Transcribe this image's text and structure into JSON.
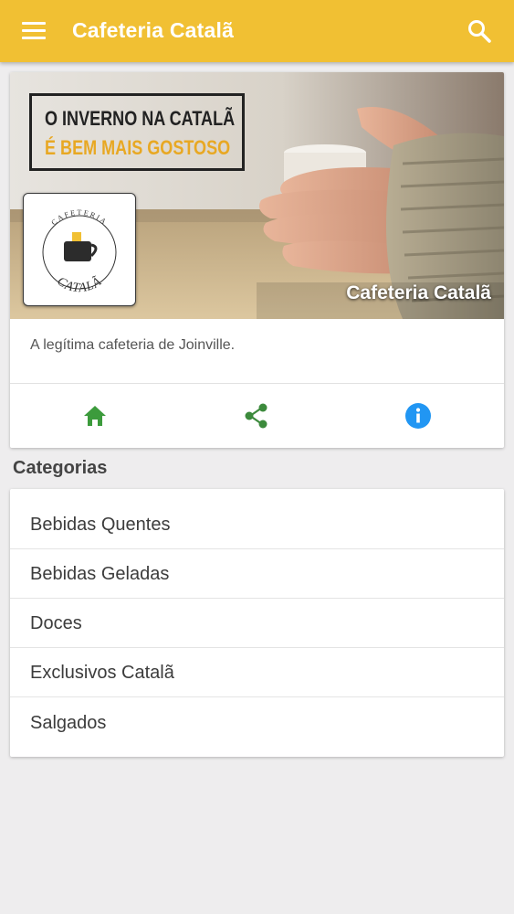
{
  "appbar": {
    "title": "Cafeteria Catalã",
    "menu_icon": "menu-icon",
    "search_icon": "search-icon",
    "color": "#f1c033"
  },
  "header_card": {
    "banner": {
      "slogan_line1": "O INVERNO NA CATALÃ",
      "slogan_line2": "É BEM MAIS GOSTOSO",
      "name": "Cafeteria Catalã",
      "logo_text_top": "CAFETERIA",
      "logo_text_bottom": "CATALÃ"
    },
    "tagline": "A legítima cafeteria de Joinville.",
    "actions": [
      {
        "icon": "home-icon",
        "color": "#3c9b3c"
      },
      {
        "icon": "share-icon",
        "color": "#3c8a3c"
      },
      {
        "icon": "info-icon",
        "color": "#2196f3"
      }
    ]
  },
  "categories": {
    "title": "Categorias",
    "items": [
      {
        "label": "Bebidas Quentes"
      },
      {
        "label": "Bebidas Geladas"
      },
      {
        "label": "Doces"
      },
      {
        "label": "Exclusivos Catalã"
      },
      {
        "label": "Salgados"
      }
    ]
  }
}
